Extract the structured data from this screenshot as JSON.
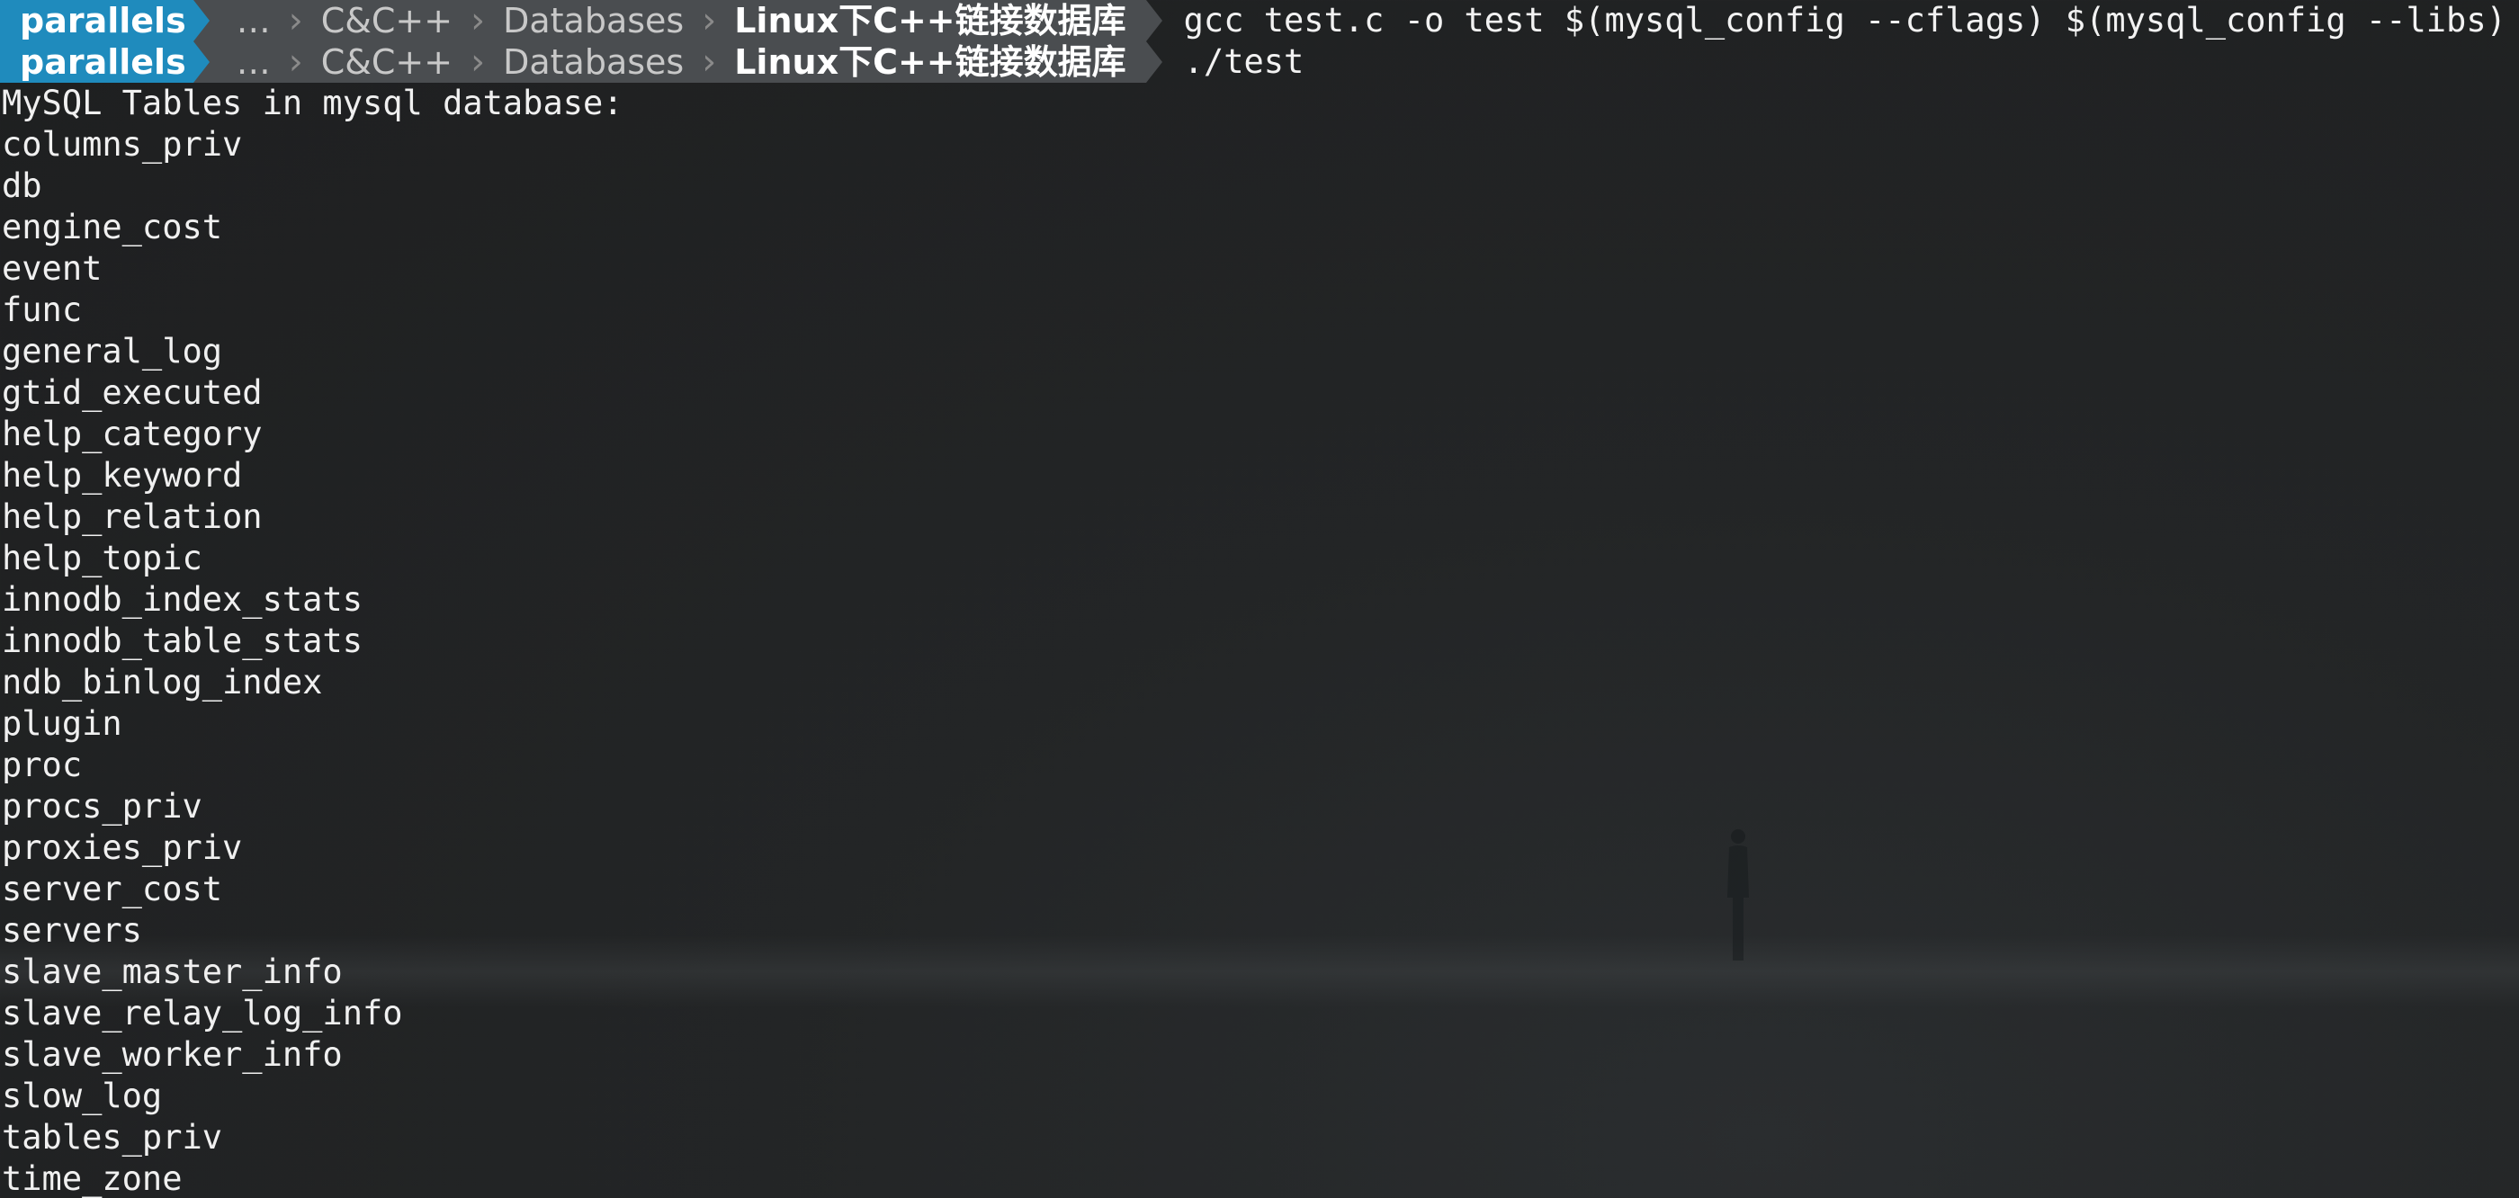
{
  "prompts": [
    {
      "user": "parallels",
      "path": [
        "…",
        "C&C++",
        "Databases"
      ],
      "cwd": "Linux下C++链接数据库",
      "command": "gcc test.c -o test $(mysql_config --cflags) $(mysql_config --libs)"
    },
    {
      "user": "parallels",
      "path": [
        "…",
        "C&C++",
        "Databases"
      ],
      "cwd": "Linux下C++链接数据库",
      "command": "./test"
    }
  ],
  "output": {
    "header": "MySQL Tables in mysql database:",
    "tables": [
      "columns_priv",
      "db",
      "engine_cost",
      "event",
      "func",
      "general_log",
      "gtid_executed",
      "help_category",
      "help_keyword",
      "help_relation",
      "help_topic",
      "innodb_index_stats",
      "innodb_table_stats",
      "ndb_binlog_index",
      "plugin",
      "proc",
      "procs_priv",
      "proxies_priv",
      "server_cost",
      "servers",
      "slave_master_info",
      "slave_relay_log_info",
      "slave_worker_info",
      "slow_log",
      "tables_priv",
      "time_zone"
    ]
  },
  "colors": {
    "user_segment": "#1f8bbd",
    "path_segment": "#4a4d50",
    "background": "#1e1f20",
    "text": "#f2f2f2"
  }
}
